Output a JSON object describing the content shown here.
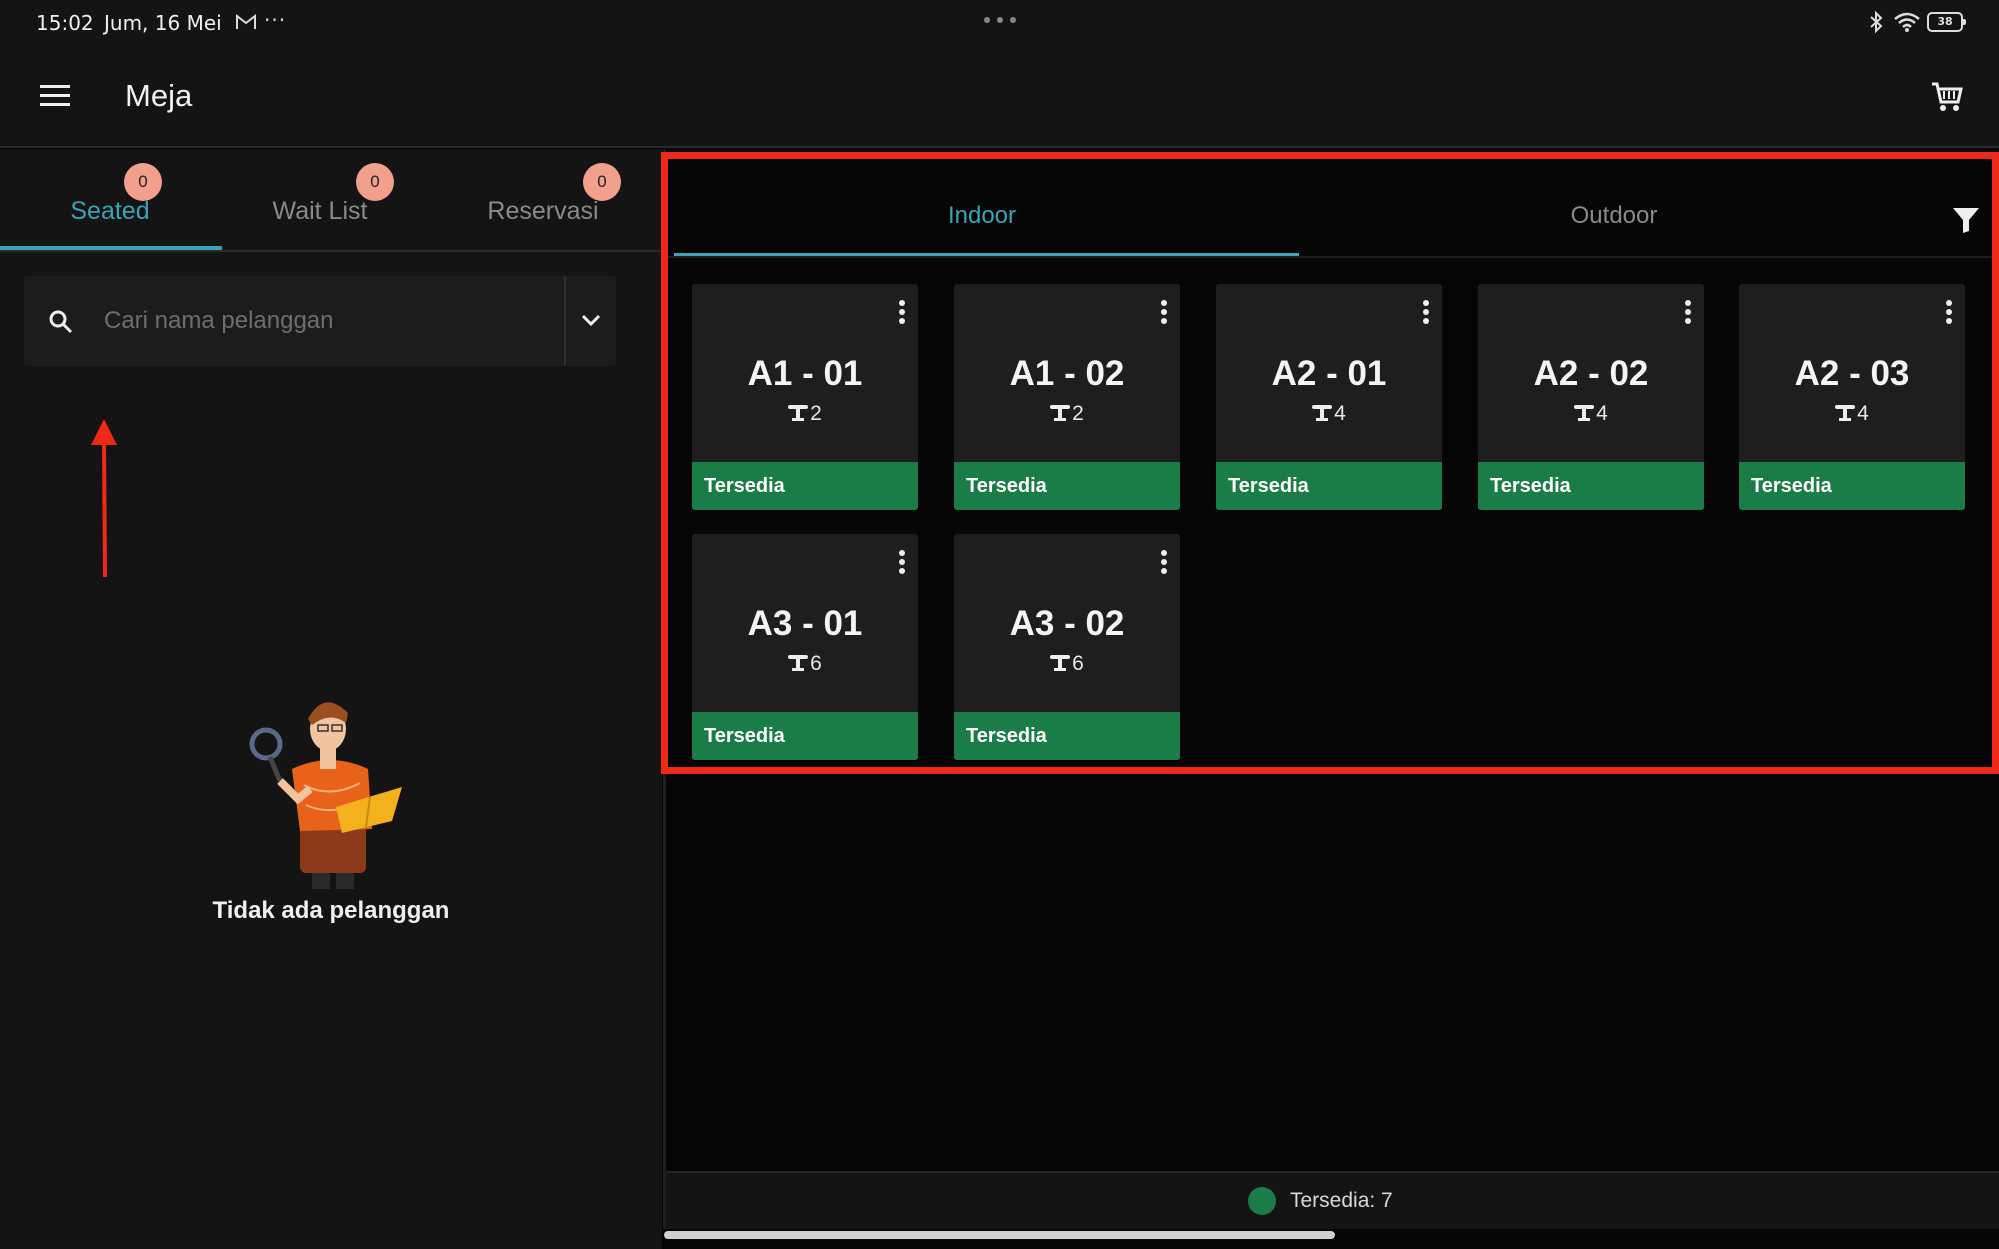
{
  "status_bar": {
    "time": "15:02",
    "date": "Jum, 16 Mei",
    "more": "···",
    "battery": "38"
  },
  "app_bar": {
    "title": "Meja"
  },
  "left_tabs": [
    {
      "label": "Seated",
      "badge": "0"
    },
    {
      "label": "Wait List",
      "badge": "0"
    },
    {
      "label": "Reservasi",
      "badge": "0"
    }
  ],
  "search": {
    "placeholder": "Cari nama pelanggan",
    "value": ""
  },
  "empty_state": {
    "message": "Tidak ada pelanggan"
  },
  "right_tabs": [
    {
      "label": "Indoor"
    },
    {
      "label": "Outdoor"
    }
  ],
  "tables": [
    {
      "name": "A1 - 01",
      "seats": "2",
      "status": "Tersedia"
    },
    {
      "name": "A1 - 02",
      "seats": "2",
      "status": "Tersedia"
    },
    {
      "name": "A2 - 01",
      "seats": "4",
      "status": "Tersedia"
    },
    {
      "name": "A2 - 02",
      "seats": "4",
      "status": "Tersedia"
    },
    {
      "name": "A2 - 03",
      "seats": "4",
      "status": "Tersedia"
    },
    {
      "name": "A3 - 01",
      "seats": "6",
      "status": "Tersedia"
    },
    {
      "name": "A3 - 02",
      "seats": "6",
      "status": "Tersedia"
    }
  ],
  "footer": {
    "legend": "Tersedia: 7"
  },
  "colors": {
    "accent": "#3aa3b8",
    "available": "#1a7c46",
    "badge": "#f2a08d",
    "annotation": "#ee2a17"
  }
}
